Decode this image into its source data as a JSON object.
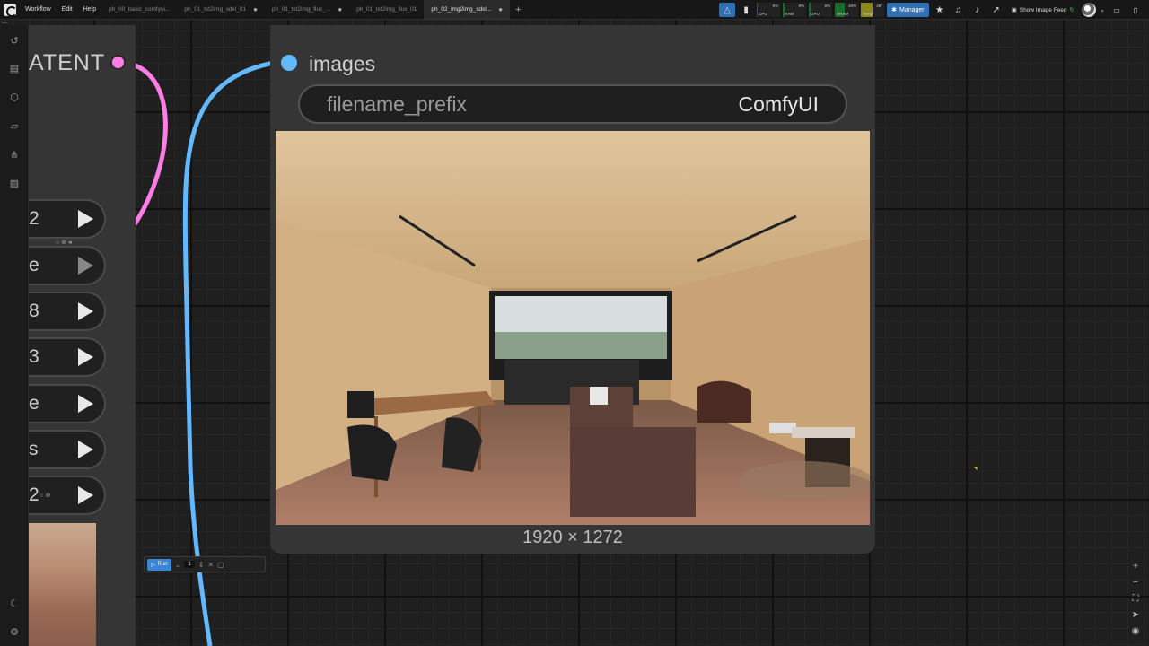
{
  "topbar": {
    "menus": [
      "Workflow",
      "Edit",
      "Help"
    ],
    "tabs": [
      {
        "label": "ph_00_basic_comfyui...",
        "active": false
      },
      {
        "label": "ph_01_txt2img_sdxl_01",
        "active": false
      },
      {
        "label": "ph_01_txt2img_flux_...",
        "active": false
      },
      {
        "label": "ph_01_txt2img_flux_01",
        "active": false
      },
      {
        "label": "ph_02_img2img_sdxl...",
        "active": true
      }
    ],
    "close_glyph": "●",
    "add_tab_glyph": "+",
    "meters": [
      {
        "label": "CPU",
        "pct": "5%",
        "level": 0.05
      },
      {
        "label": "RAM",
        "pct": "8%",
        "level": 0.08
      },
      {
        "label": "GPU",
        "pct": "6%",
        "level": 0.06
      },
      {
        "label": "VRAM",
        "pct": "40%",
        "level": 0.4
      },
      {
        "label": "Temp",
        "pct": "49°",
        "level": 0.49
      }
    ],
    "manager_label": "Manager",
    "show_feed_label": "Show Image Feed",
    "sub_label": "kde"
  },
  "left_node": {
    "output_label": "ATENT",
    "widgets": [
      {
        "value": "2",
        "arrow_dim": false
      },
      {
        "value": "e",
        "arrow_dim": true
      },
      {
        "value": "8",
        "arrow_dim": false
      },
      {
        "value": "3",
        "arrow_dim": false
      },
      {
        "value": "e",
        "arrow_dim": false
      },
      {
        "value": "s",
        "arrow_dim": false
      },
      {
        "value": "2",
        "arrow_dim": false
      }
    ]
  },
  "save_node": {
    "input_label": "images",
    "widget_key": "filename_prefix",
    "widget_value": "ComfyUI",
    "image_dims": "1920 × 1272"
  },
  "run_widget": {
    "label": "Run",
    "count": "1"
  },
  "colors": {
    "latent_link": "#ff7de6",
    "image_link": "#63b8ff",
    "accent": "#2f6fb4"
  }
}
